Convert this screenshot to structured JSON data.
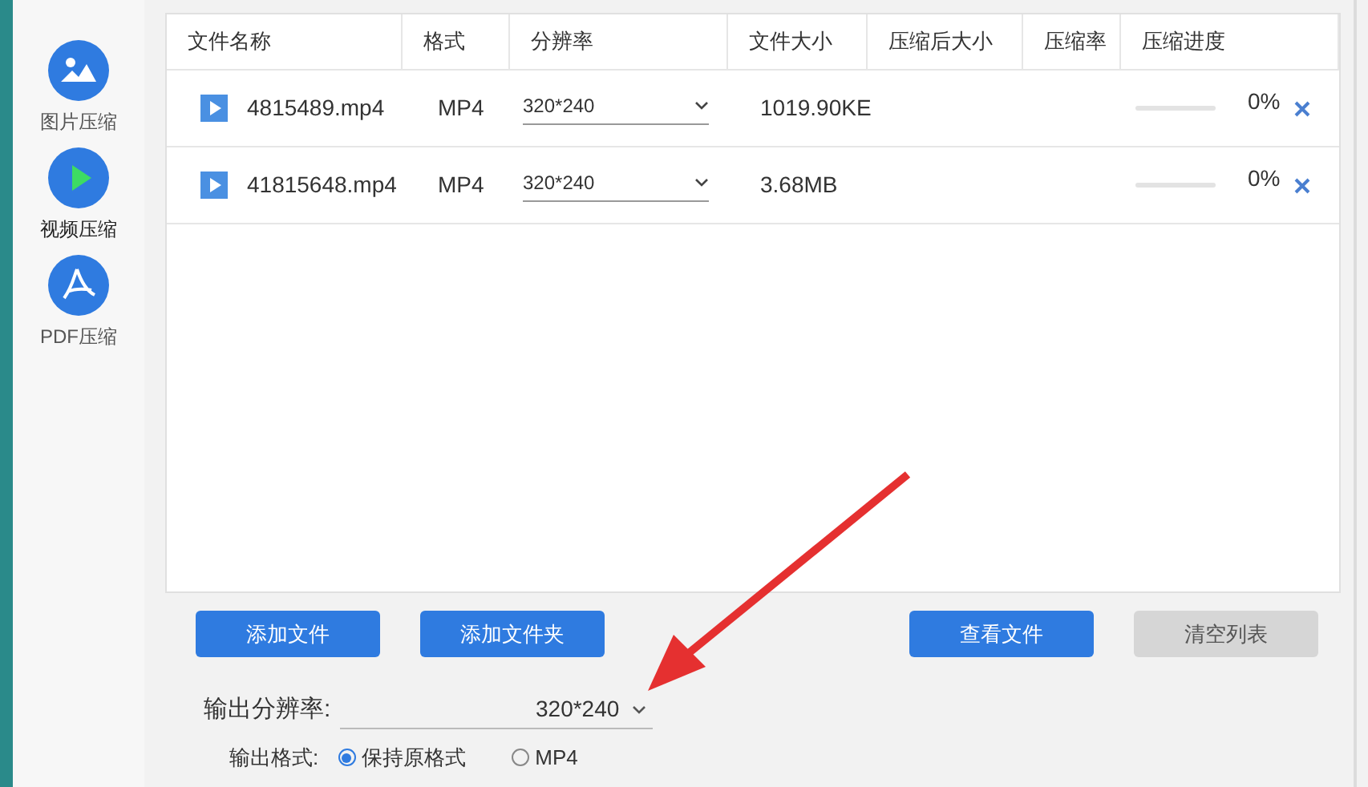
{
  "sidebar": {
    "items": [
      {
        "kind": "image",
        "label": "图片压缩",
        "selected": false
      },
      {
        "kind": "video",
        "label": "视频压缩",
        "selected": true
      },
      {
        "kind": "pdf",
        "label": "PDF压缩",
        "selected": false
      }
    ]
  },
  "table": {
    "columns": [
      "文件名称",
      "格式",
      "分辨率",
      "文件大小",
      "压缩后大小",
      "压缩率",
      "压缩进度"
    ],
    "rows": [
      {
        "name": "4815489.mp4",
        "format": "MP4",
        "resolution": "320*240",
        "size": "1019.90KE",
        "level": 0,
        "percent": "0%"
      },
      {
        "name": "41815648.mp4",
        "format": "MP4",
        "resolution": "320*240",
        "size": "3.68MB",
        "level": 0,
        "percent": "0%"
      }
    ]
  },
  "buttons": [
    {
      "label": "添加文件",
      "disabled": false
    },
    {
      "label": "添加文件夹",
      "disabled": false
    },
    {
      "label": "查看文件",
      "disabled": false
    },
    {
      "label": "清空列表",
      "disabled": true
    }
  ],
  "output_resolution": {
    "label": "输出分辨率:",
    "value": "320*240"
  },
  "output_format": {
    "label": "输出格式:",
    "options": [
      {
        "label": "保持原格式",
        "selected": true
      },
      {
        "label": "MP4",
        "selected": false
      }
    ]
  }
}
